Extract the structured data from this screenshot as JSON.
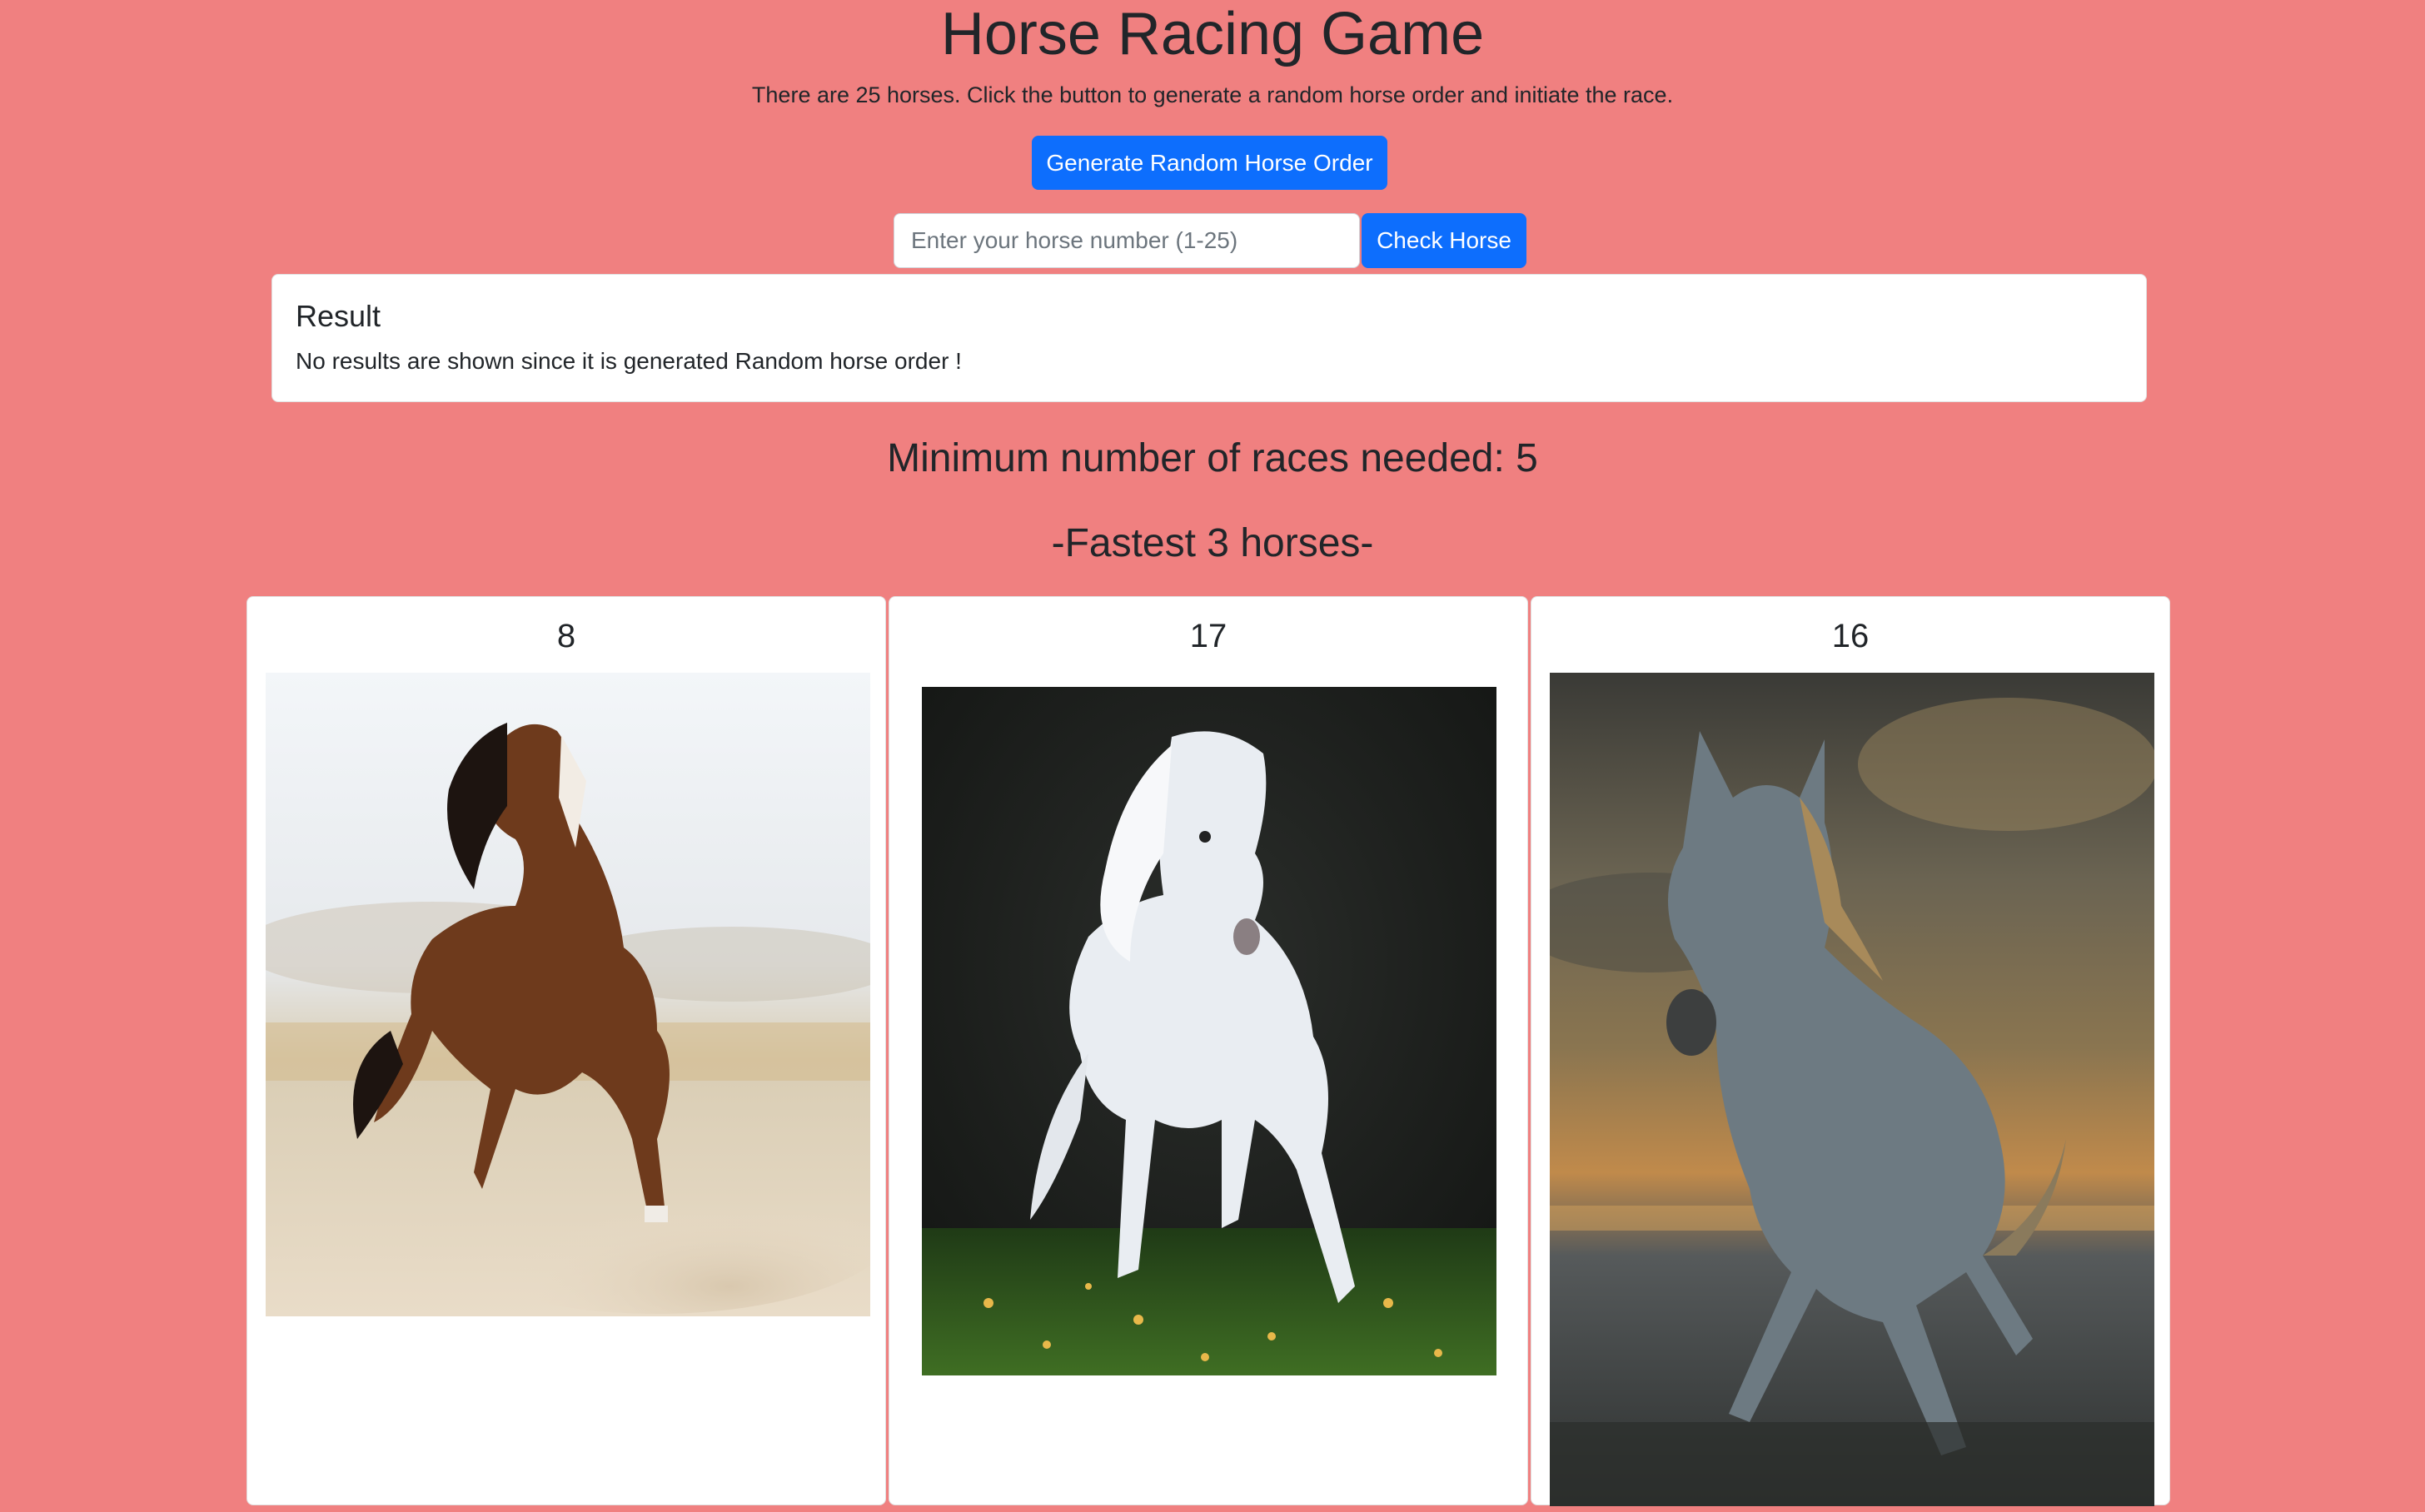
{
  "page": {
    "title": "Horse Racing Game",
    "intro": "There are 25 horses. Click the button to generate a random horse order and initiate the race.",
    "background_color": "#f08080"
  },
  "controls": {
    "generate_label": "Generate Random Horse Order",
    "input_placeholder": "Enter your horse number (1-25)",
    "input_value": "",
    "check_label": "Check Horse",
    "accent_color": "#0d6efd"
  },
  "result": {
    "title": "Result",
    "text": "No results are shown since it is generated Random horse order !"
  },
  "summary": {
    "min_races": "Minimum number of races needed: 5",
    "fastest_heading": "-Fastest 3 horses-"
  },
  "fastest_horses": [
    {
      "number": "8",
      "image": "brown-horse-galloping-in-desert-photo"
    },
    {
      "number": "17",
      "image": "white-horse-painting-dark-background-photo"
    },
    {
      "number": "16",
      "image": "grey-horse-running-stormy-sky-painting-photo"
    }
  ]
}
